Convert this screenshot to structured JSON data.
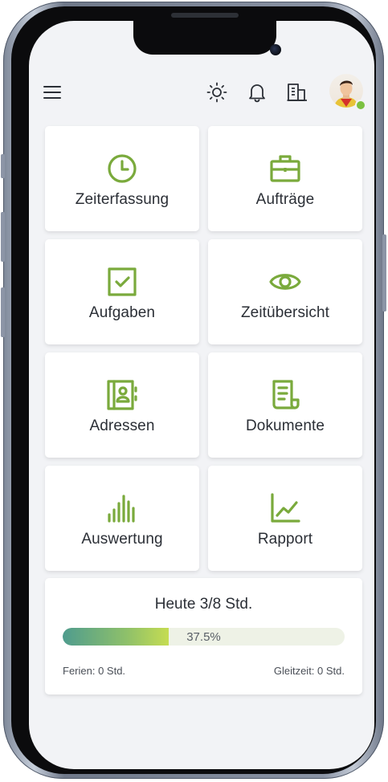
{
  "colors": {
    "accent": "#7aaa3c",
    "icon_dark": "#2b2f36",
    "background": "#f2f3f6",
    "online": "#7cc141"
  },
  "topbar": {
    "menu_icon": "hamburger-menu-icon",
    "theme_icon": "sun-icon",
    "notifications_icon": "bell-icon",
    "company_icon": "building-icon",
    "avatar_status": "online"
  },
  "tiles": [
    {
      "label": "Zeiterfassung",
      "icon": "clock-icon"
    },
    {
      "label": "Aufträge",
      "icon": "briefcase-icon"
    },
    {
      "label": "Aufgaben",
      "icon": "checkbox-icon"
    },
    {
      "label": "Zeitübersicht",
      "icon": "eye-icon"
    },
    {
      "label": "Adressen",
      "icon": "address-book-icon"
    },
    {
      "label": "Dokumente",
      "icon": "document-icon"
    },
    {
      "label": "Auswertung",
      "icon": "bar-chart-icon"
    },
    {
      "label": "Rapport",
      "icon": "line-chart-icon"
    }
  ],
  "today": {
    "title": "Heute 3/8 Std.",
    "progress_label": "37.5%",
    "progress_value": 0.375,
    "vacation": "Ferien: 0 Std.",
    "flextime": "Gleitzeit: 0 Std."
  }
}
